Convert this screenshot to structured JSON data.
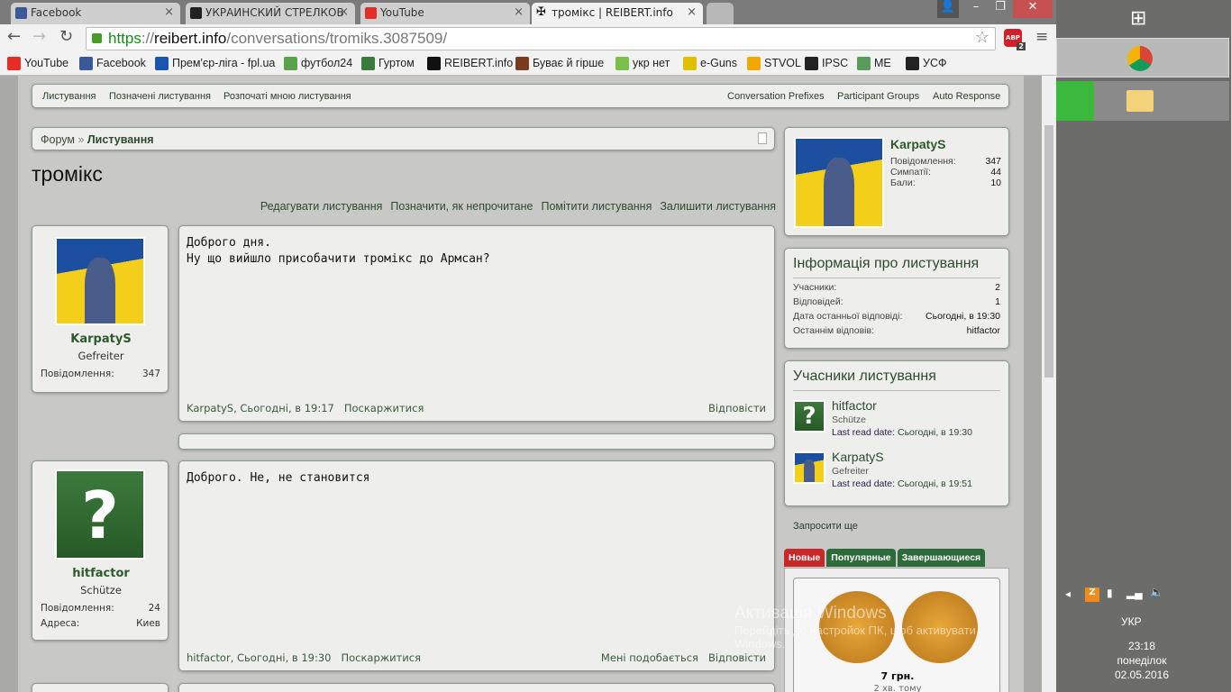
{
  "browser": {
    "tabs": [
      {
        "label": "Facebook",
        "icon": "facebook-icon",
        "color": "#3b5998"
      },
      {
        "label": "УКРАИНСКИЙ СТРЕЛКОВ",
        "icon": "usf-shield-icon",
        "color": "#222"
      },
      {
        "label": "YouTube",
        "icon": "youtube-icon",
        "color": "#e52d27"
      },
      {
        "label": "тромікс | REIBERT.info",
        "icon": "iron-cross-icon",
        "color": "#111",
        "active": true
      }
    ],
    "url_scheme": "https",
    "url_host": "reibert.info",
    "url_path": "/conversations/tromiks.3087509/",
    "url_sep": "://",
    "abp_badge": "2",
    "bookmarks": [
      {
        "label": "YouTube",
        "color": "#e52d27"
      },
      {
        "label": "Facebook",
        "color": "#3b5998"
      },
      {
        "label": "Прем'єр-ліга - fpl.ua",
        "color": "#1a56b0"
      },
      {
        "label": "футбол24",
        "color": "#5ba34a"
      },
      {
        "label": "Гуртом",
        "color": "#3a7a3a"
      },
      {
        "label": "REIBERT.info",
        "color": "#111"
      },
      {
        "label": "Буває й гірше",
        "color": "#7a3b20"
      },
      {
        "label": "укр нет",
        "color": "#7cbf4a"
      },
      {
        "label": "e-Guns",
        "color": "#e0c000"
      },
      {
        "label": "STVOL",
        "color": "#f0a800"
      },
      {
        "label": "IPSC",
        "color": "#222"
      },
      {
        "label": "ME",
        "color": "#5a9a5a"
      },
      {
        "label": "УСФ",
        "color": "#222"
      }
    ]
  },
  "nav": {
    "left": [
      "Листування",
      "Позначені листування",
      "Розпочаті мною листування"
    ],
    "right": [
      "Conversation Prefixes",
      "Participant Groups",
      "Auto Response"
    ]
  },
  "breadcrumb": {
    "home": "Форум",
    "separator": "»",
    "current": "Листування"
  },
  "title": "тромікс",
  "actions": [
    "Редагувати листування",
    "Позначити, як непрочитане",
    "Помітити листування",
    "Залишити листування"
  ],
  "messages": [
    {
      "user": "KarpatyS",
      "rank": "Gefreiter",
      "stats": [
        {
          "label": "Повідомлення:",
          "value": "347"
        }
      ],
      "lines": [
        "Доброго дня.",
        "Ну що вийшло присобачити тромікс до Армсан?"
      ],
      "author": "KarpatyS",
      "date": "Сьогодні, в 19:17",
      "report": "Поскаржитися",
      "like": "",
      "reply": "Відповісти",
      "avatar": "flag"
    },
    {
      "user": "hitfactor",
      "rank": "Schütze",
      "stats": [
        {
          "label": "Повідомлення:",
          "value": "24"
        },
        {
          "label": "Адреса:",
          "value": "Киев"
        }
      ],
      "lines": [
        "Доброго. Не, не становится"
      ],
      "author": "hitfactor",
      "date": "Сьогодні, в 19:30",
      "report": "Поскаржитися",
      "like": "Мені подобається",
      "reply": "Відповісти",
      "avatar": "question"
    }
  ],
  "sidebar": {
    "profile": {
      "name": "KarpatyS",
      "stats": [
        {
          "label": "Повідомлення:",
          "value": "347"
        },
        {
          "label": "Симпатії:",
          "value": "44"
        },
        {
          "label": "Бали:",
          "value": "10"
        }
      ]
    },
    "info": {
      "title": "Інформація про листування",
      "rows": [
        {
          "label": "Учасники:",
          "value": "2"
        },
        {
          "label": "Відповідей:",
          "value": "1"
        },
        {
          "label": "Дата останньої відповіді:",
          "value": "Сьогодні, в 19:30"
        },
        {
          "label": "Останнім відповів:",
          "value": "hitfactor"
        }
      ]
    },
    "participants": {
      "title": "Учасники листування",
      "items": [
        {
          "name": "hitfactor",
          "rank": "Schütze",
          "read_label": "Last read date:",
          "read": "Сьогодні, в 19:30"
        },
        {
          "name": "KarpatyS",
          "rank": "Gefreiter",
          "read_label": "Last read date:",
          "read": "Сьогодні, в 19:51"
        }
      ]
    },
    "invite": "Запросити ще",
    "market_tabs": [
      {
        "label": "Новые",
        "color": "#c8282a"
      },
      {
        "label": "Популярные",
        "color": "#2e6b3a"
      },
      {
        "label": "Завершающиеся",
        "color": "#2e6b3a"
      }
    ],
    "item": {
      "price": "7 грн.",
      "age": "2 хв. тому"
    }
  },
  "watermark": {
    "title": "Активація Windows",
    "text": "Перейдіть до настройок ПК, щоб активувати Windows."
  },
  "tray": {
    "lang": "УКР",
    "time": "23:18",
    "day": "понеділок",
    "date": "02.05.2016"
  }
}
